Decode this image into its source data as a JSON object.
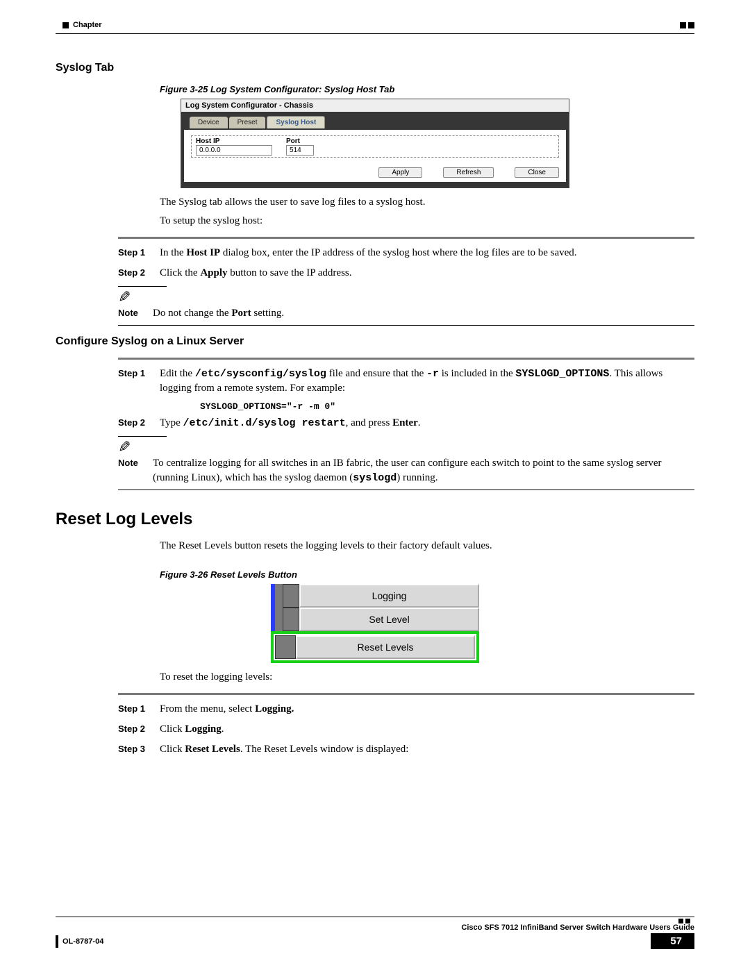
{
  "header": {
    "chapter": "Chapter"
  },
  "section1": {
    "title": "Syslog Tab",
    "fig_caption": "Figure 3-25   Log System Configurator: Syslog Host Tab",
    "intro1": "The Syslog tab allows the user to save log files to a syslog host.",
    "intro2": "To setup the syslog host:",
    "step1_label": "Step 1",
    "step1_a": "In the ",
    "step1_b": "Host IP",
    "step1_c": " dialog box, enter the IP address of the syslog host where the log files are to be saved.",
    "step2_label": "Step 2",
    "step2_a": "Click the ",
    "step2_b": "Apply",
    "step2_c": " button to save the IP address.",
    "note_label": "Note",
    "note_a": "Do not change the ",
    "note_b": "Port",
    "note_c": " setting."
  },
  "fig25": {
    "window_title": "Log System Configurator - Chassis",
    "tab_device": "Device",
    "tab_preset": "Preset",
    "tab_syslog": "Syslog Host",
    "host_ip_label": "Host IP",
    "host_ip_value": "0.0.0.0",
    "port_label": "Port",
    "port_value": "514",
    "btn_apply": "Apply",
    "btn_refresh": "Refresh",
    "btn_close": "Close"
  },
  "section2": {
    "title": "Configure Syslog on a Linux Server",
    "step1_label": "Step 1",
    "step1_a": "Edit the ",
    "step1_b": "/etc/sysconfig/syslog",
    "step1_c": " file and ensure that the ",
    "step1_d": "-r",
    "step1_e": " is included in the ",
    "step1_f": "SYSLOGD_OPTIONS",
    "step1_g": ". This allows logging from a remote system. For example:",
    "code": "SYSLOGD_OPTIONS=\"-r -m 0\"",
    "step2_label": "Step 2",
    "step2_a": "Type ",
    "step2_b": "/etc/init.d/syslog restart",
    "step2_c": ", and press ",
    "step2_d": "Enter",
    "step2_e": ".",
    "note_label": "Note",
    "note_a": "To centralize logging for all switches in an IB fabric, the user can configure each switch to point to the same syslog server (running Linux), which has the syslog daemon (",
    "note_b": "syslogd",
    "note_c": ") running."
  },
  "section3": {
    "title": "Reset Log Levels",
    "intro": "The Reset Levels button resets the logging levels to their factory default values.",
    "fig_caption": "Figure 3-26   Reset Levels Button",
    "reset_prompt": "To reset the logging levels:",
    "step1_label": "Step 1",
    "step1_a": "From the menu, select ",
    "step1_b": "Logging.",
    "step2_label": "Step 2",
    "step2_a": "Click ",
    "step2_b": "Logging",
    "step2_c": ".",
    "step3_label": "Step 3",
    "step3_a": "Click ",
    "step3_b": "Reset Levels",
    "step3_c": ". The Reset Levels window is displayed:"
  },
  "fig26": {
    "btn1": "Logging",
    "btn2": "Set Level",
    "btn3": "Reset Levels"
  },
  "footer": {
    "guide": "Cisco SFS 7012 InfiniBand Server Switch Hardware Users Guide",
    "doc": "OL-8787-04",
    "page": "57"
  }
}
